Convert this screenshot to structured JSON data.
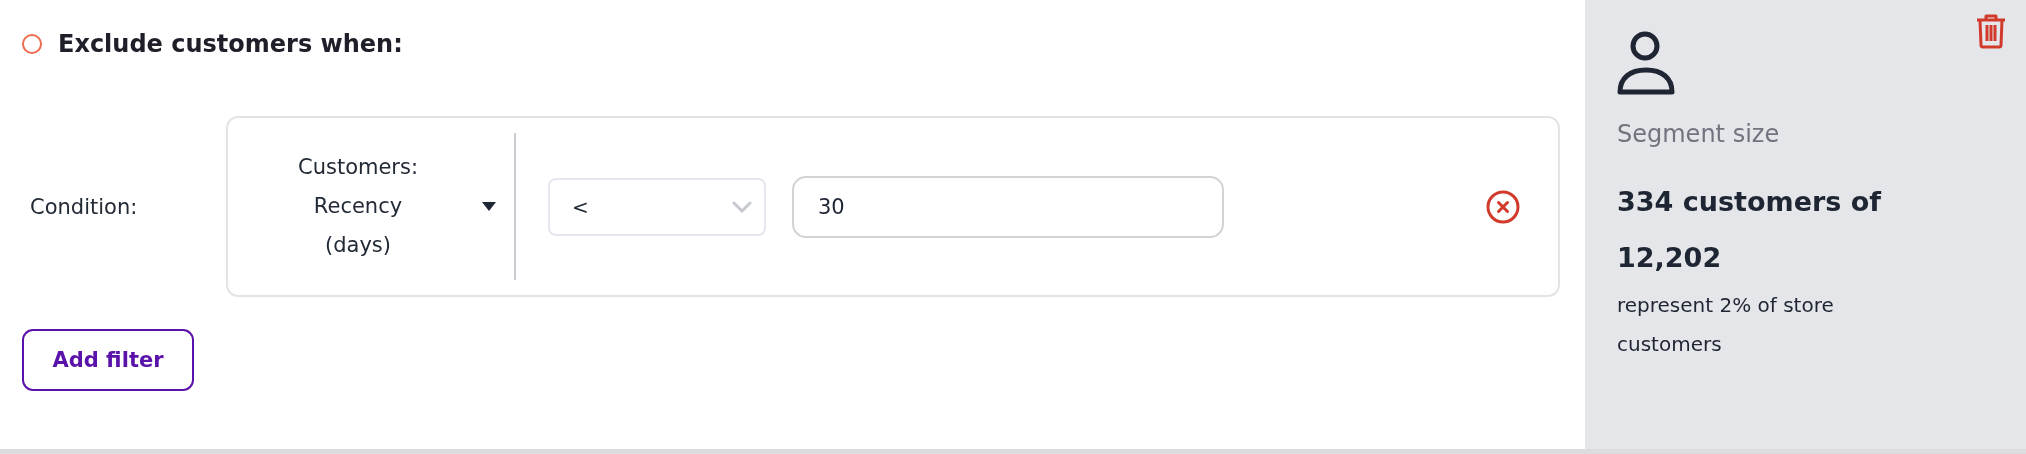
{
  "rule": {
    "checked": false,
    "title": "Exclude customers when:"
  },
  "condition": {
    "label": "Condition:",
    "field": {
      "lines": [
        "Customers:",
        "Recency",
        "(days)"
      ]
    },
    "operator": {
      "value": "<"
    },
    "value": {
      "value": "30"
    }
  },
  "add_filter": {
    "label": "Add filter"
  },
  "segment": {
    "title": "Segment size",
    "count": "334 customers of 12,202",
    "description": "represent 2% of store customers"
  }
}
